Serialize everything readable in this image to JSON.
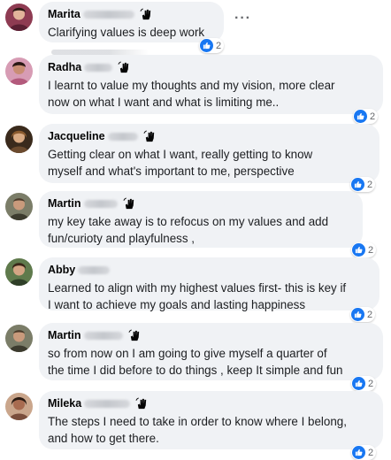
{
  "comments": [
    {
      "name": "Marita",
      "text": "Clarifying values is deep work",
      "reactions": "2",
      "avatar_color": "#8e3b52"
    },
    {
      "name": "Radha",
      "text": "I learnt to value my thoughts and my vision, more clear\nnow on what I want and what is limiting me..",
      "reactions": "2",
      "avatar_color": "#b35a7c"
    },
    {
      "name": "Jacqueline",
      "text": "Getting clear on what I want, really getting to know\nmyself and what's important to me, perspective",
      "reactions": "2",
      "avatar_color": "#6b4a2e"
    },
    {
      "name": "Martin",
      "text": "my key take away is to refocus on my values and add\nfun/curioty and playfulness ,",
      "reactions": "2",
      "avatar_color": "#5c5a45"
    },
    {
      "name": "Abby",
      "text": "Learned to align with my highest values first- this is key if\nI want to achieve my goals and lasting happiness",
      "reactions": "2",
      "avatar_color": "#3f5a38"
    },
    {
      "name": "Martin",
      "text": "so from now on I am going to give myself a quarter of\nthe time I did before to do things , keep It simple and fun",
      "reactions": "2",
      "avatar_color": "#5c5a45"
    },
    {
      "name": "Mileka",
      "text": "The steps I need to take in order to know where I belong,\nand how to get there.",
      "reactions": "2",
      "avatar_color": "#7a4e3c"
    }
  ],
  "colors": {
    "bubble": "#f0f2f5",
    "like": "#1877f2",
    "meta": "#65676b"
  },
  "icons": {
    "wave": "waving-hand-icon",
    "like": "thumbs-up-icon",
    "more": "more-options-icon"
  }
}
